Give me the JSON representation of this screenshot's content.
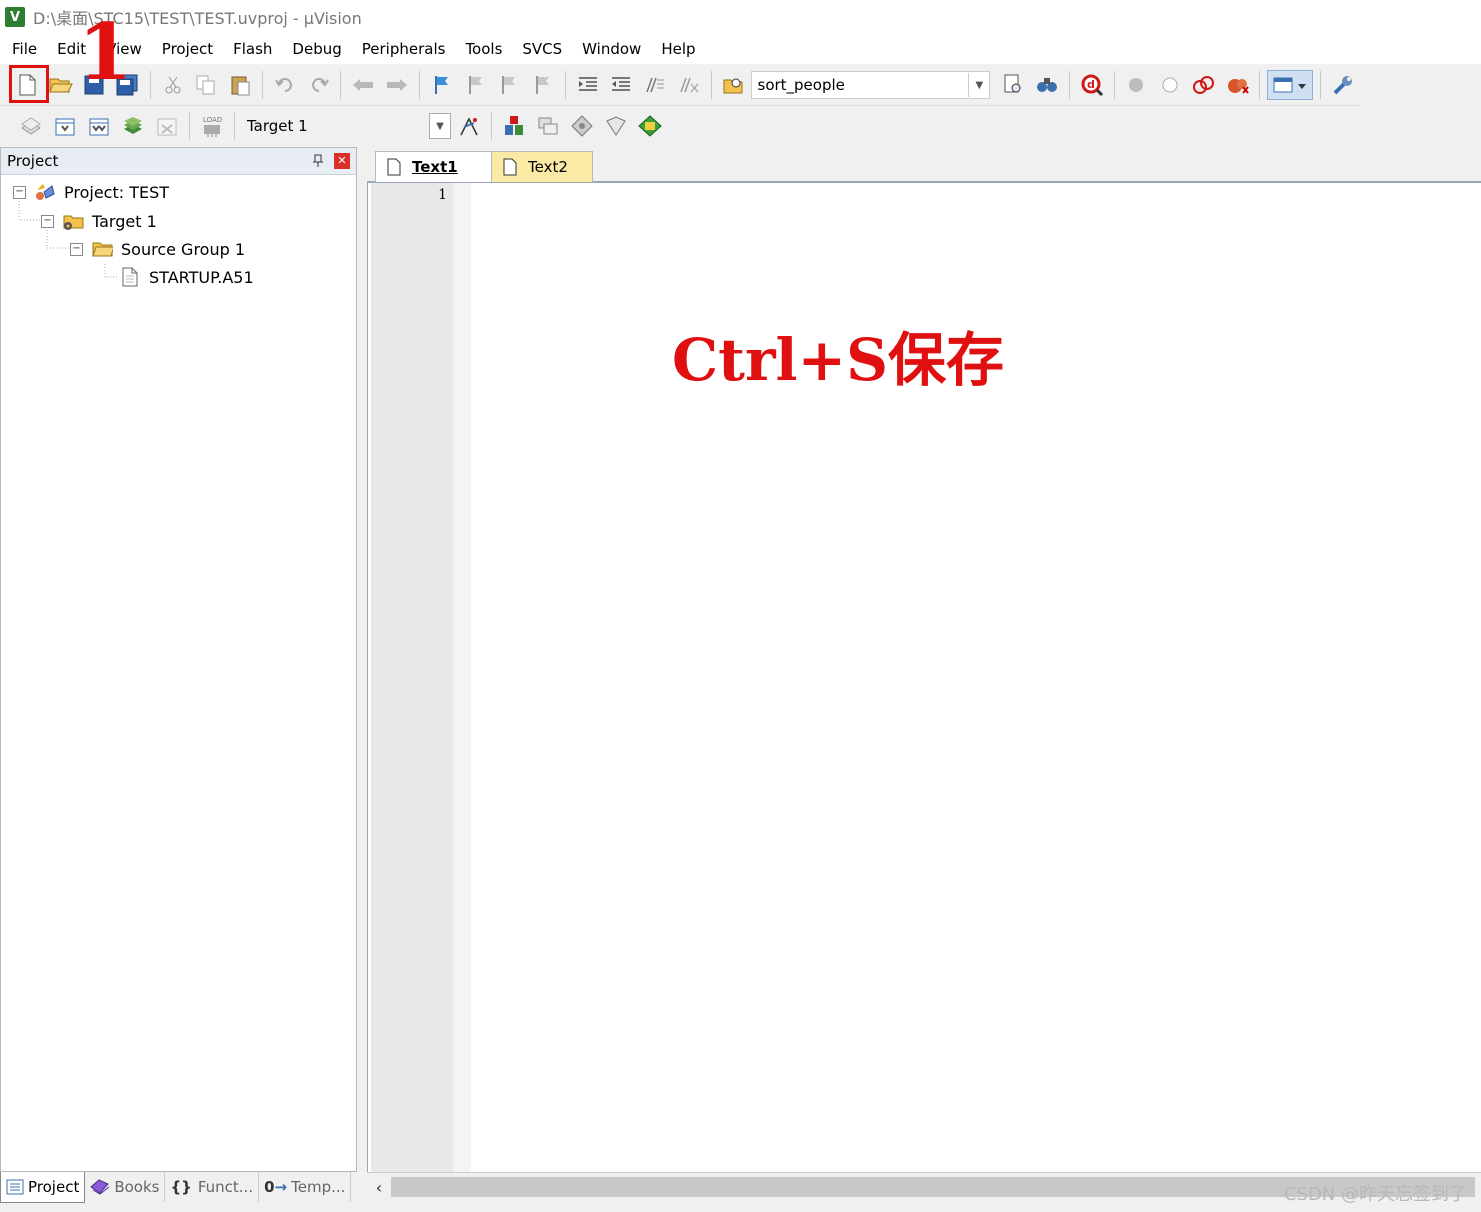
{
  "window": {
    "title": "D:\\桌面\\STC15\\TEST\\TEST.uvproj - µVision",
    "app_icon": "V"
  },
  "menu": [
    "File",
    "Edit",
    "View",
    "Project",
    "Flash",
    "Debug",
    "Peripherals",
    "Tools",
    "SVCS",
    "Window",
    "Help"
  ],
  "toolbar": {
    "find_combo_value": "sort_people",
    "target_combo_value": "Target 1"
  },
  "annotation": {
    "step_number": "1",
    "shortcut_text": "Ctrl+S保存",
    "color": "#e01010"
  },
  "project_panel": {
    "title": "Project",
    "tree": {
      "project": "Project: TEST",
      "target": "Target 1",
      "group": "Source Group 1",
      "file": "STARTUP.A51"
    },
    "bottom_tabs": [
      "Project",
      "Books",
      "Funct...",
      "Temp..."
    ]
  },
  "editor": {
    "tabs": [
      {
        "label": "Text1",
        "active": true
      },
      {
        "label": "Text2",
        "active": false
      }
    ],
    "line_numbers": [
      "1"
    ]
  },
  "watermark": "CSDN @昨天忘签到了"
}
